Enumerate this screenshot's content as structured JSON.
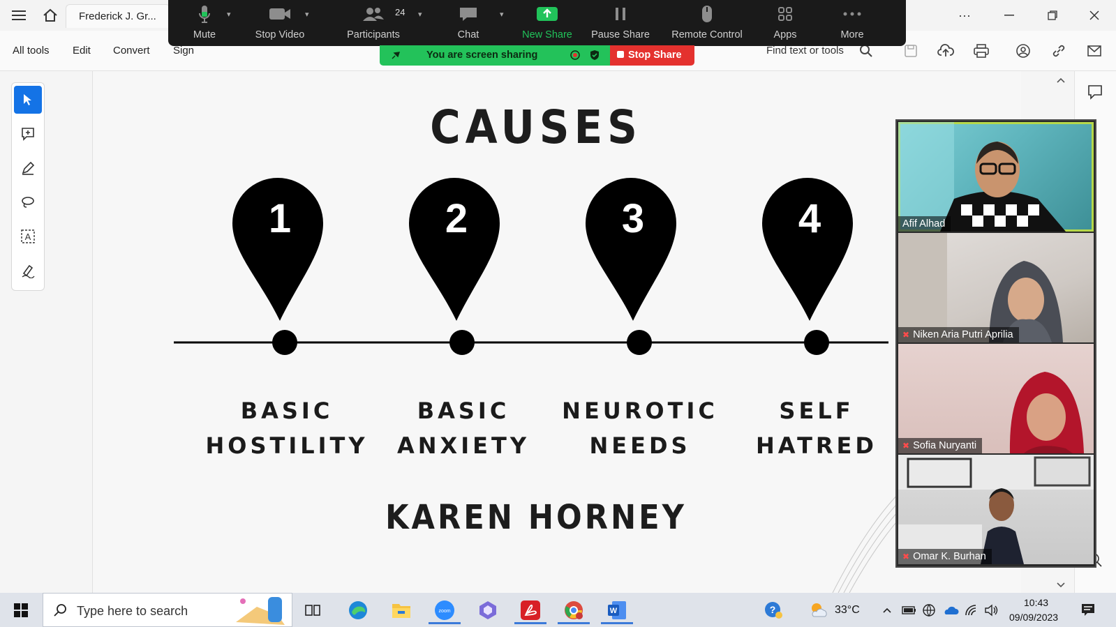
{
  "acrobat": {
    "doc_tab_title": "Frederick J. Gr...",
    "menu": [
      "All tools",
      "Edit",
      "Convert",
      "Sign"
    ],
    "find_placeholder": "Find text or tools"
  },
  "zoom_toolbar": {
    "mute": "Mute",
    "stop_video": "Stop Video",
    "participants": "Participants",
    "participants_count": "24",
    "chat": "Chat",
    "new_share": "New Share",
    "pause_share": "Pause Share",
    "remote_control": "Remote Control",
    "apps": "Apps",
    "more": "More"
  },
  "share_banner": {
    "text": "You are screen sharing",
    "stop": "Stop Share"
  },
  "slide": {
    "title": "CAUSES",
    "subtitle": "KAREN HORNEY",
    "causes": [
      {
        "number": "1",
        "line1": "BASIC",
        "line2": "HOSTILITY"
      },
      {
        "number": "2",
        "line1": "BASIC",
        "line2": "ANXIETY"
      },
      {
        "number": "3",
        "line1": "NEUROTIC",
        "line2": "NEEDS"
      },
      {
        "number": "4",
        "line1": "SELF",
        "line2": "HATRED"
      }
    ]
  },
  "participants": [
    {
      "name": "Afif Alhad",
      "muted": false
    },
    {
      "name": "Niken Aria Putri Aprilia",
      "muted": true
    },
    {
      "name": "Sofia Nuryanti",
      "muted": true
    },
    {
      "name": "Omar K. Burhan",
      "muted": true
    }
  ],
  "taskbar": {
    "search_placeholder": "Type here to search",
    "weather": "33°C",
    "time": "10:43",
    "date": "09/09/2023"
  },
  "colors": {
    "zoom_green": "#21c35a",
    "stop_red": "#e4312e",
    "acrobat_blue": "#1473e6",
    "active_speaker": "#b6d84a"
  }
}
